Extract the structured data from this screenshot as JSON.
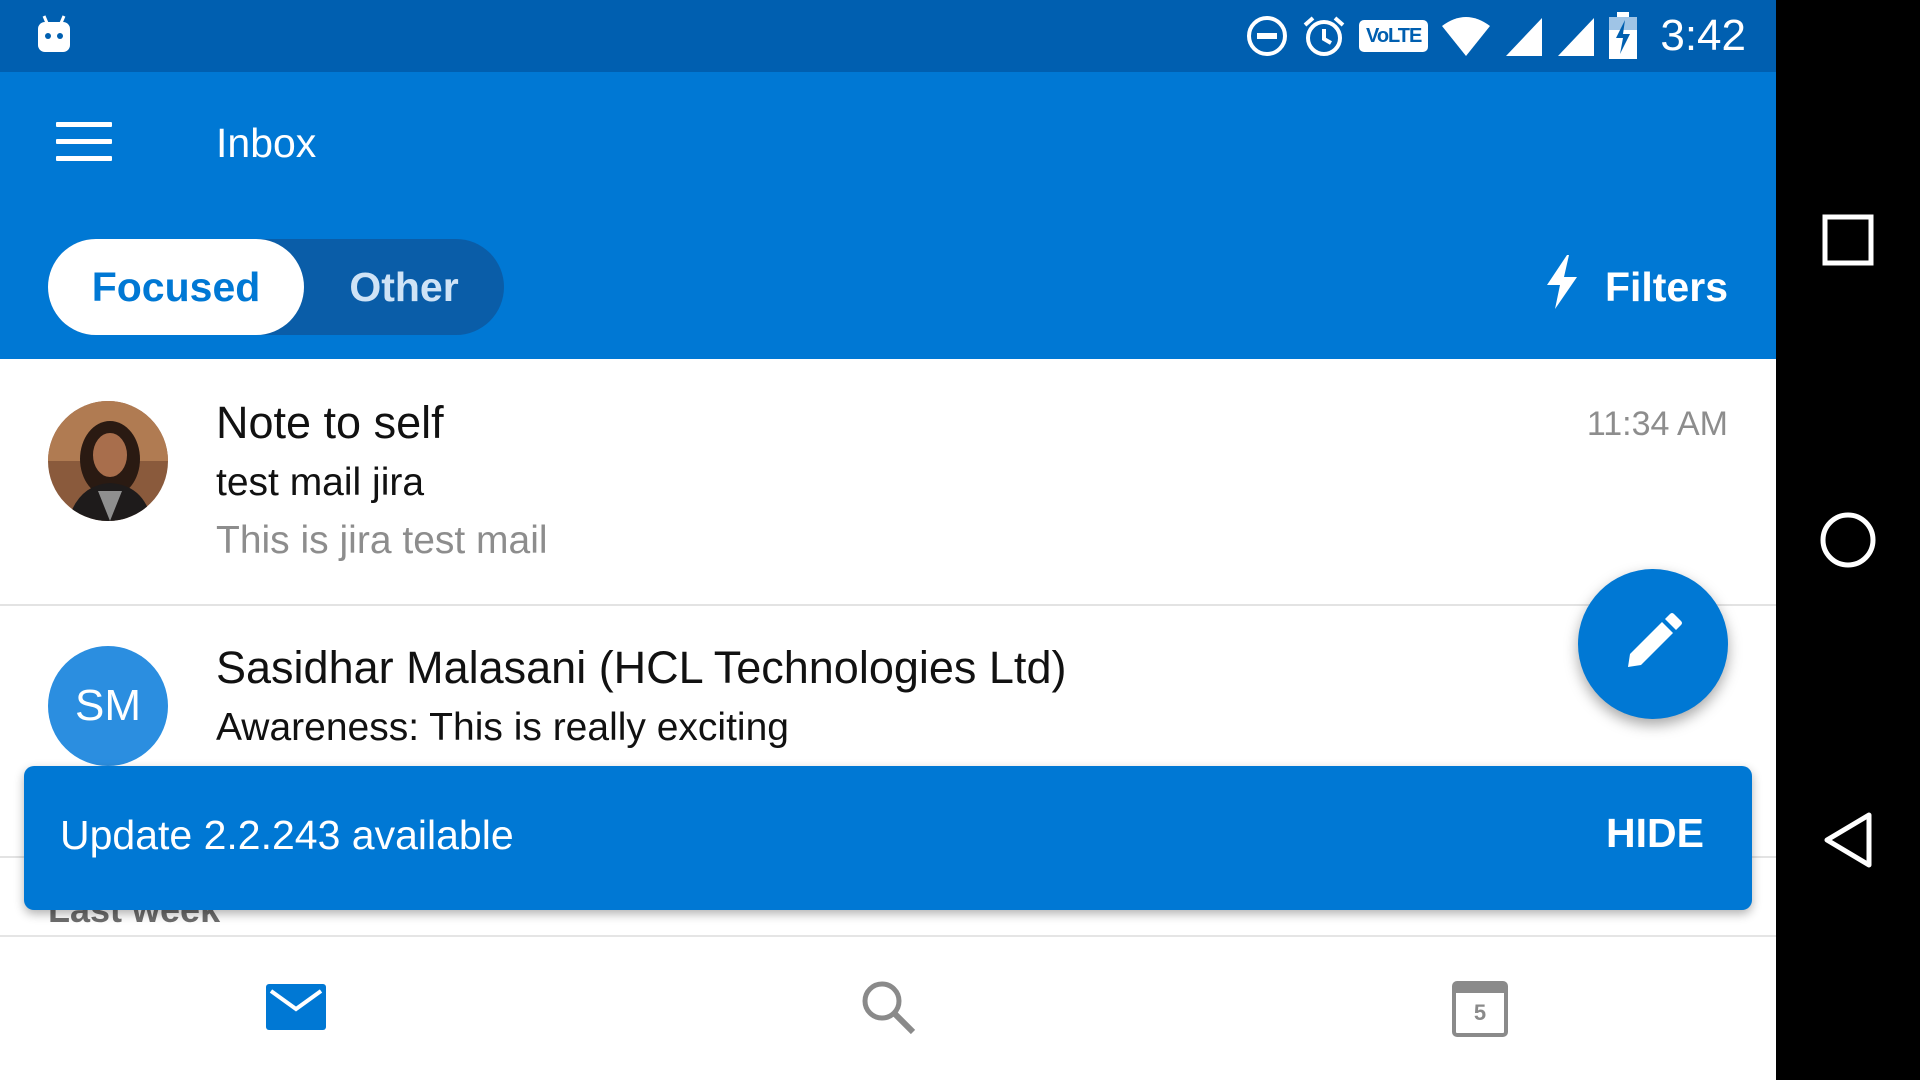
{
  "status_bar": {
    "time": "3:42",
    "volte_label": "VoLTE",
    "icons": [
      "android-icon",
      "do-not-disturb-icon",
      "alarm-icon",
      "volte-icon",
      "wifi-icon",
      "signal-icon",
      "signal-icon",
      "battery-icon"
    ]
  },
  "app_bar": {
    "title": "Inbox",
    "menu_icon": "hamburger-menu-icon",
    "tabs": [
      {
        "label": "Focused",
        "selected": true
      },
      {
        "label": "Other",
        "selected": false
      }
    ],
    "filters_label": "Filters",
    "filters_icon": "lightning-icon"
  },
  "messages": [
    {
      "sender": "Note to self",
      "subject": "test mail jira",
      "preview": "This is jira test mail",
      "time": "11:34 AM",
      "avatar": "photo-avatar"
    },
    {
      "sender": "Sasidhar Malasani (HCL Technologies Ltd)",
      "subject": "Awareness: This is really exciting",
      "initials": "SM",
      "avatar": "initials-avatar"
    }
  ],
  "section_header": "Last week",
  "snackbar": {
    "message": "Update 2.2.243 available",
    "action": "HIDE"
  },
  "fab": {
    "icon": "pencil-compose-icon"
  },
  "bottom_tabs": [
    {
      "icon": "mail-icon",
      "active": true
    },
    {
      "icon": "search-icon",
      "active": false
    },
    {
      "icon": "calendar-icon",
      "active": false,
      "calendar_day": "5"
    }
  ],
  "system_nav": {
    "icons": [
      "recents-square-icon",
      "home-circle-icon",
      "back-triangle-icon"
    ]
  },
  "colors": {
    "status_bar": "#005fb0",
    "accent": "#0078d4",
    "toggle_track": "#0a5da8",
    "initials_avatar": "#2b8ee0",
    "secondary_text": "#8d8d8d"
  }
}
